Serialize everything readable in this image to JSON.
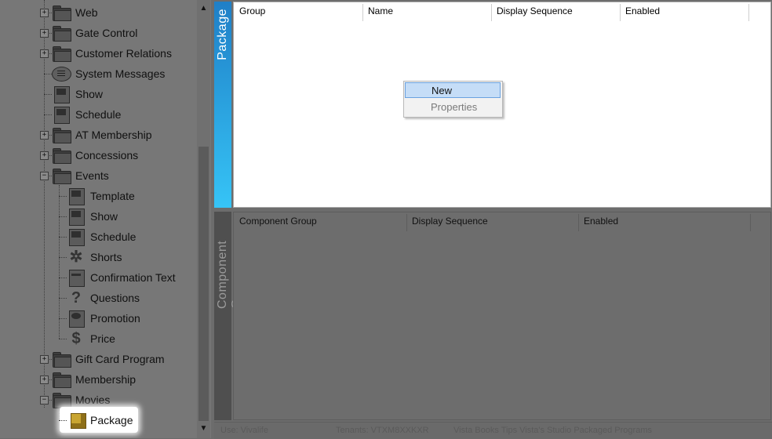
{
  "tree": {
    "items": [
      {
        "label": "Web",
        "icon": "folder-icon"
      },
      {
        "label": "Gate Control",
        "icon": "folder-icon"
      },
      {
        "label": "Customer Relations",
        "icon": "folder-icon"
      },
      {
        "label": "System Messages",
        "icon": "speech-bubble-icon"
      },
      {
        "label": "Show",
        "icon": "film-show-icon"
      },
      {
        "label": "Schedule",
        "icon": "schedule-icon"
      },
      {
        "label": "AT Membership",
        "icon": "folder-icon"
      },
      {
        "label": "Concessions",
        "icon": "folder-icon"
      },
      {
        "label": "Events",
        "icon": "folder-open-icon"
      },
      {
        "label": "Template",
        "icon": "ticket-template-icon"
      },
      {
        "label": "Show",
        "icon": "film-show-icon"
      },
      {
        "label": "Schedule",
        "icon": "schedule-icon"
      },
      {
        "label": "Shorts",
        "icon": "shorts-icon"
      },
      {
        "label": "Confirmation Text",
        "icon": "confirmation-text-icon"
      },
      {
        "label": "Questions",
        "icon": "question-mark-icon"
      },
      {
        "label": "Promotion",
        "icon": "promotion-icon"
      },
      {
        "label": "Price",
        "icon": "dollar-icon"
      },
      {
        "label": "Gift Card Program",
        "icon": "folder-icon"
      },
      {
        "label": "Membership",
        "icon": "folder-icon"
      },
      {
        "label": "Movies",
        "icon": "folder-open-icon"
      },
      {
        "label": "Package",
        "icon": "package-cube-icon",
        "selected": true
      }
    ]
  },
  "package_panel": {
    "tab_label": "Package",
    "columns": [
      "Group",
      "Name",
      "Display Sequence",
      "Enabled"
    ]
  },
  "component_panel": {
    "tab_label": "Component Group",
    "columns": [
      "Component Group",
      "Display Sequence",
      "Enabled"
    ]
  },
  "context_menu": {
    "items": [
      {
        "label": "New",
        "highlighted": true
      },
      {
        "label": "Properties",
        "disabled": true
      }
    ]
  },
  "status_bar": {
    "segments": [
      "Use: Vivalife",
      "Tenants: VTXM8XXKXR",
      "Vista Books Tips Vista's Studio Packaged Programs"
    ]
  },
  "colors": {
    "package_tab_top": "#1f7fc7",
    "package_tab_bottom": "#36c4f6",
    "menu_highlight": "#c5ddf7"
  }
}
